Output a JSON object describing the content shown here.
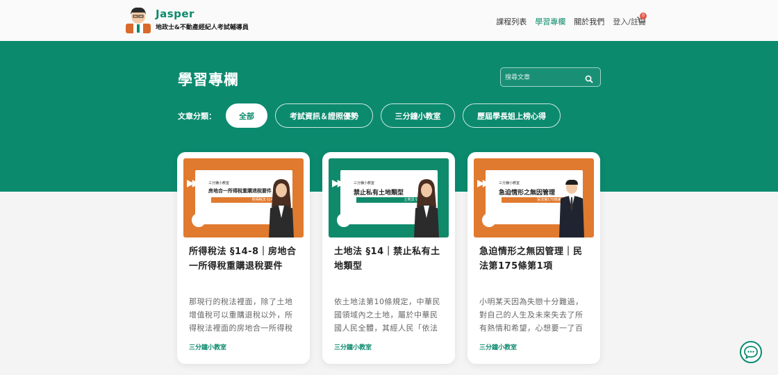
{
  "header": {
    "brand_name": "Jasper",
    "brand_subtitle": "地政士&不動產經紀人考試輔導員",
    "nav": [
      {
        "label": "課程列表",
        "active": false
      },
      {
        "label": "學習專欄",
        "active": true
      },
      {
        "label": "關於我們",
        "active": false
      },
      {
        "label": "登入/註冊",
        "active": false
      }
    ],
    "cart_count": "0",
    "cart_icon": "cart-icon"
  },
  "hero": {
    "title": "學習專欄",
    "search_placeholder": "搜尋文章",
    "filter_label": "文章分類：",
    "filters": [
      {
        "label": "全部",
        "active": true
      },
      {
        "label": "考試資訊＆證照優勢",
        "active": false
      },
      {
        "label": "三分鐘小教室",
        "active": false
      },
      {
        "label": "歷屆學長姐上榜心得",
        "active": false
      }
    ]
  },
  "cards": [
    {
      "thumb_color": "orange",
      "thumb_small": "三分鐘小教室",
      "thumb_title": "房地合一所得稅重購退稅要件",
      "thumb_tag": "所得稅法 §14-8",
      "title": "所得稅法 §14-8｜房地合一所得稅重購退稅要件",
      "excerpt": "那現行的稅法裡面，除了土地增值稅可以重購退稅以外，所得稅法裡面的房地合一所得稅也是可",
      "category": "三分鐘小教室"
    },
    {
      "thumb_color": "green",
      "thumb_small": "三分鐘小教室",
      "thumb_title": "禁止私有土地類型",
      "thumb_tag": "土地法 §14",
      "title": "土地法 §14｜禁止私有土地類型",
      "excerpt": "依土地法第10條規定，中華民國領域內之土地，屬於中華民國人民全體，其經人民「依法取得",
      "category": "三分鐘小教室"
    },
    {
      "thumb_color": "orange",
      "thumb_small": "三分鐘小教室",
      "thumb_title": "急迫情形之無因管理",
      "thumb_tag": "民法第175條第1項",
      "title": "急迫情形之無因管理｜民法第175條第1項",
      "excerpt": "小明某天因為失戀十分難過，對自己的人生及未來失去了所有熱情和希望，心想要一了百了，因",
      "category": "三分鐘小教室"
    }
  ],
  "colors": {
    "primary": "#0b8a6e",
    "accent_orange": "#e07a2f",
    "badge_red": "#e25a4d"
  }
}
